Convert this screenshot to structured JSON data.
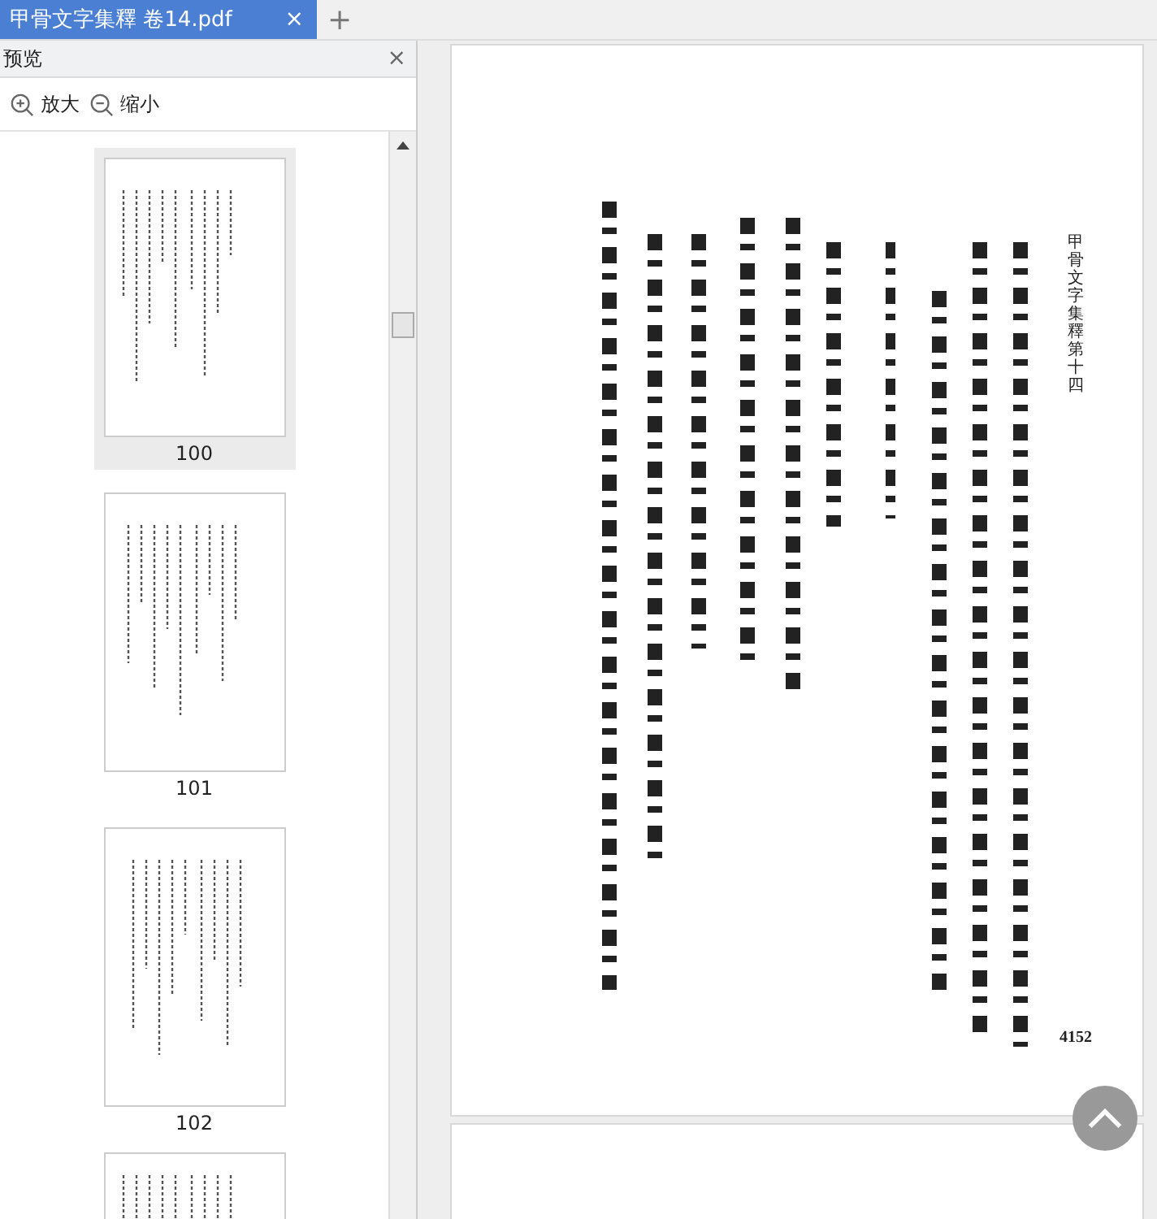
{
  "tabs": [
    {
      "label": "甲骨文字集釋 卷14.pdf",
      "selected": true,
      "close": "×"
    }
  ],
  "new_tab": "+",
  "sidebar": {
    "title": "预览",
    "close": "×",
    "zoom_in": "放大",
    "zoom_out": "缩小",
    "thumbnails": [
      {
        "label": "100",
        "selected": true
      },
      {
        "label": "101",
        "selected": false
      },
      {
        "label": "102",
        "selected": false
      }
    ]
  },
  "page": {
    "header": "甲骨文字集釋第十四",
    "page_number": "4152"
  }
}
